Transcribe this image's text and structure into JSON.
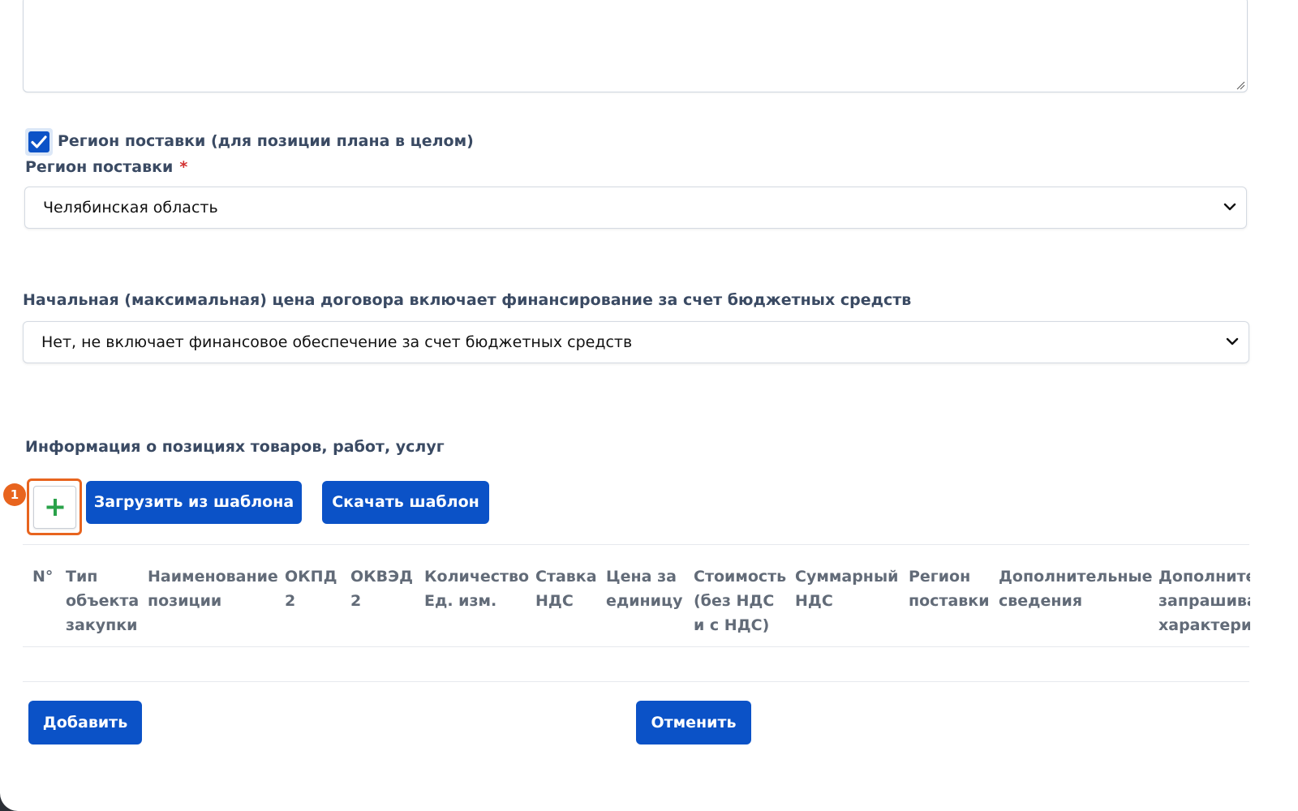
{
  "checkbox": {
    "label": "Регион поставки (для позиции плана в целом)",
    "checked": true
  },
  "region": {
    "label": "Регион поставки",
    "required_mark": "*",
    "value": "Челябинская область"
  },
  "budget": {
    "label": "Начальная (максимальная) цена договора включает финансирование за счет бюджетных средств",
    "value": "Нет, не включает финансовое обеспечение за счет бюджетных средств"
  },
  "positions": {
    "title": "Информация о позициях товаров, работ, услуг",
    "add_icon": "plus-icon",
    "badge": "1",
    "load_template_label": "Загрузить из шаблона",
    "download_template_label": "Скачать шаблон"
  },
  "table": {
    "headers": [
      {
        "lines": [
          "N°"
        ]
      },
      {
        "lines": [
          "Тип",
          "объекта",
          "закупки"
        ]
      },
      {
        "lines": [
          "Наименование",
          "позиции"
        ]
      },
      {
        "lines": [
          "ОКПД",
          "2"
        ]
      },
      {
        "lines": [
          "ОКВЭД",
          "2"
        ]
      },
      {
        "lines": [
          "Количество",
          "Ед. изм."
        ]
      },
      {
        "lines": [
          "Ставка",
          "НДС"
        ]
      },
      {
        "lines": [
          "Цена за",
          "единицу"
        ]
      },
      {
        "lines": [
          "Стоимость",
          "(без НДС",
          "и с НДС)"
        ]
      },
      {
        "lines": [
          "Суммарный",
          "НДС"
        ]
      },
      {
        "lines": [
          "Регион",
          "поставки"
        ]
      },
      {
        "lines": [
          "Дополнительные",
          "сведения"
        ]
      },
      {
        "lines": [
          "Дополнительные",
          "запрашиваемые",
          "характеристики"
        ]
      }
    ]
  },
  "footer": {
    "add_label": "Добавить",
    "cancel_label": "Отменить"
  },
  "colors": {
    "primary": "#0b52c7",
    "highlight": "#e8641e",
    "plus": "#2aa24a"
  }
}
